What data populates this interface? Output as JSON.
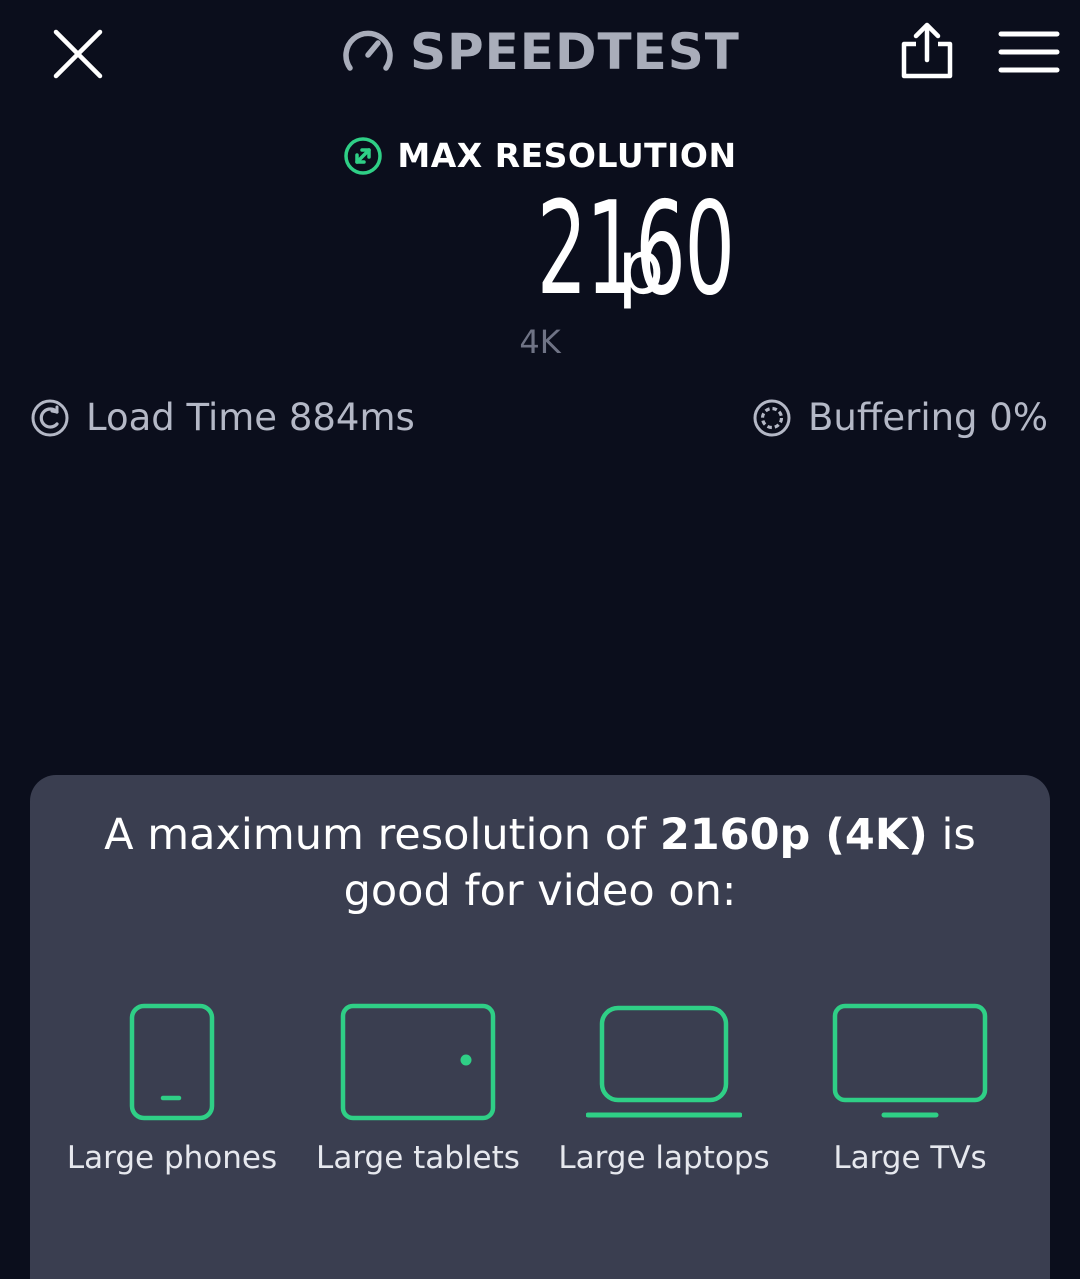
{
  "header": {
    "brand": "SPEEDTEST"
  },
  "result": {
    "label": "MAX RESOLUTION",
    "value": "2160",
    "unit": "p",
    "sublabel": "4K"
  },
  "stats": {
    "load_time": "Load Time 884ms",
    "buffering": "Buffering 0%"
  },
  "card": {
    "heading_pre": "A maximum resolution of ",
    "heading_bold": "2160p (4K)",
    "heading_post": " is good for video on:",
    "devices": [
      {
        "label": "Large phones",
        "icon": "phone-icon"
      },
      {
        "label": "Large tablets",
        "icon": "tablet-icon"
      },
      {
        "label": "Large laptops",
        "icon": "laptop-icon"
      },
      {
        "label": "Large TVs",
        "icon": "tv-icon"
      }
    ]
  },
  "colors": {
    "background": "#0b0e1c",
    "card": "#3a3e50",
    "accent_green": "#2fcf86",
    "muted_text": "#b4b8c6"
  }
}
